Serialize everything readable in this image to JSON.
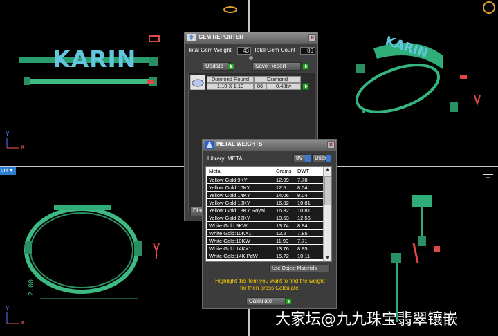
{
  "viewport": {
    "label": "ont",
    "top_left_text": "KARIN",
    "top_right_text": "KARIN",
    "dimension_text": "2.00",
    "axis_y": "y",
    "axis_x": "x"
  },
  "gem_reporter": {
    "title": "GEM REPORTER",
    "total_weight_label": "Total Gem Weight",
    "total_weight_value": "43",
    "total_count_label": "Total Gem Count",
    "total_count_value": "86",
    "update_label": "Update",
    "save_report_label": "Save Report",
    "gem_row": {
      "cut": "Diamond Round",
      "type": "Diamond",
      "size": "1.10 X 1.10",
      "count": "86",
      "weight": "0.43tw"
    },
    "bottom_button_label": "Diam"
  },
  "metal_weights": {
    "title": "METAL WEIGHTS",
    "library_label": "Library: METAL",
    "btn_8v": "8V",
    "btn_user": "User",
    "columns": [
      "Metal",
      "Grams",
      "DWT"
    ],
    "rows": [
      {
        "metal": "Yellow Gold:9KY",
        "grams": "12.09",
        "dwt": "7.78"
      },
      {
        "metal": "Yellow Gold:10KY",
        "grams": "12.5",
        "dwt": "8.04"
      },
      {
        "metal": "Yellow Gold:14KY",
        "grams": "14.06",
        "dwt": "9.04"
      },
      {
        "metal": "Yellow Gold:18KY",
        "grams": "16.82",
        "dwt": "10.81"
      },
      {
        "metal": "Yellow Gold:18KY Royal",
        "grams": "16.82",
        "dwt": "10.81"
      },
      {
        "metal": "Yellow Gold:22KY",
        "grams": "19.53",
        "dwt": "12.56"
      },
      {
        "metal": "White Gold:9KW",
        "grams": "13.74",
        "dwt": "8.84"
      },
      {
        "metal": "White Gold:10KX1",
        "grams": "12.2",
        "dwt": "7.85"
      },
      {
        "metal": "White Gold:10KW",
        "grams": "11.99",
        "dwt": "7.71"
      },
      {
        "metal": "White Gold:14KX1",
        "grams": "13.76",
        "dwt": "8.85"
      },
      {
        "metal": "White Gold:14K PdW",
        "grams": "15.72",
        "dwt": "10.11"
      }
    ],
    "use_object_materials": "Use Object Materials",
    "hint_line1": "Highlight the item you want to find the weight",
    "hint_line2": "for then press Calculate.",
    "calculate_label": "Calculate"
  },
  "watermark": "大家坛@九九珠宝翡翠镶嵌"
}
